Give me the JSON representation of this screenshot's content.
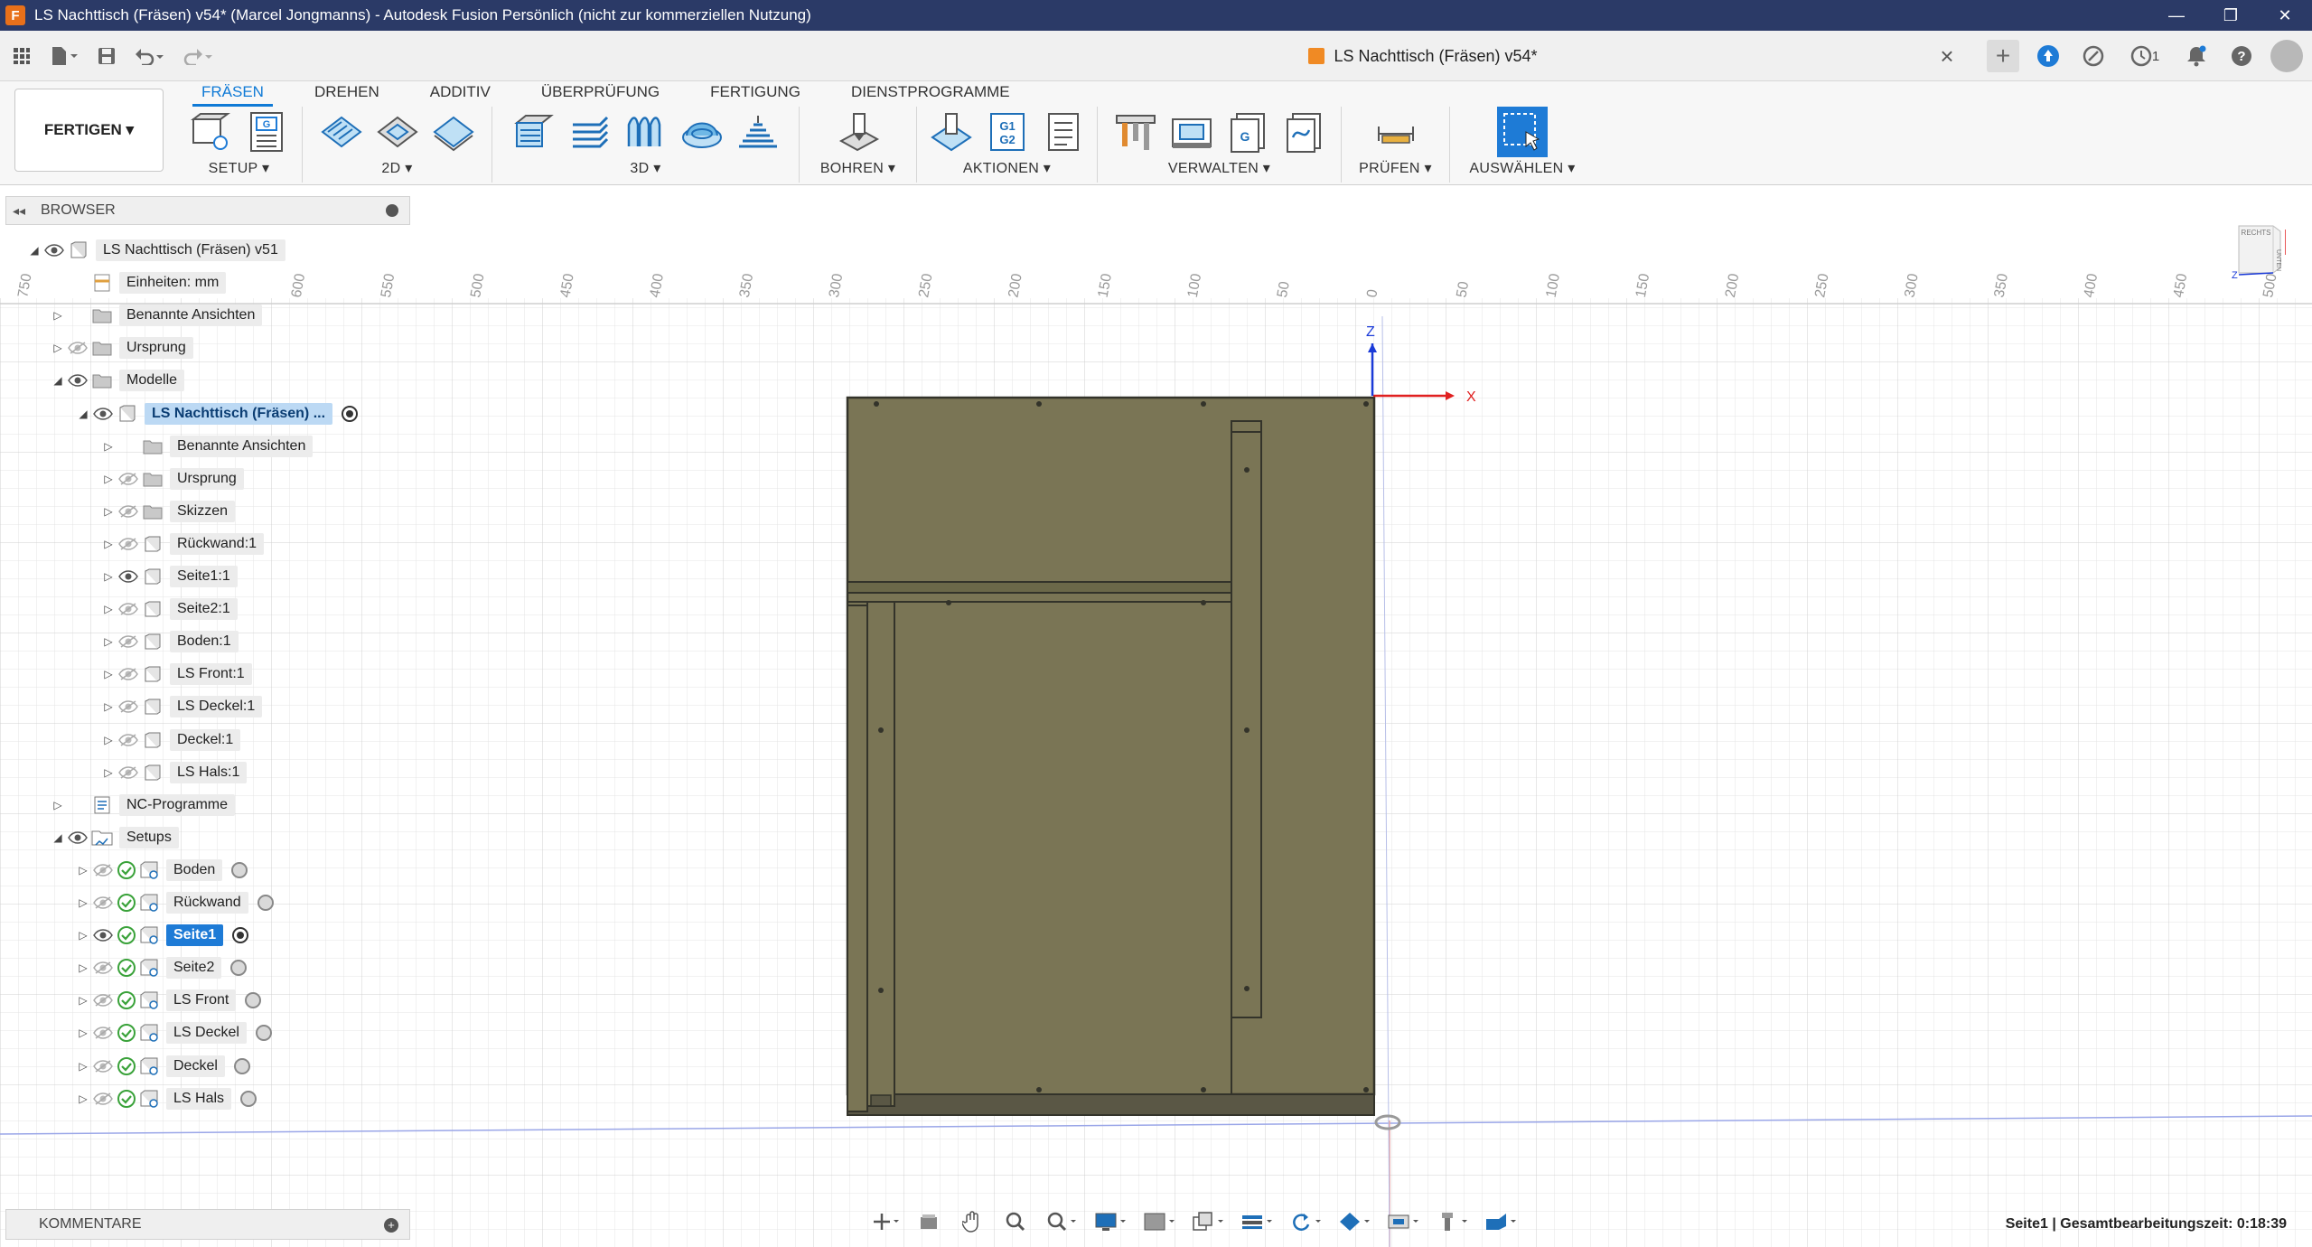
{
  "window": {
    "title": "LS Nachttisch (Fräsen) v54* (Marcel Jongmanns) - Autodesk Fusion Persönlich (nicht zur kommerziellen Nutzung)",
    "app_icon_letter": "F",
    "controls": [
      "—",
      "❐",
      "✕"
    ]
  },
  "document_tab": {
    "title": "LS Nachttisch (Fräsen) v54*"
  },
  "notifications": {
    "job_count": "1"
  },
  "workspace": {
    "label": "FERTIGEN ▾"
  },
  "ribbon": {
    "tabs": [
      {
        "label": "FRÄSEN",
        "active": true
      },
      {
        "label": "DREHEN"
      },
      {
        "label": "ADDITIV"
      },
      {
        "label": "ÜBERPRÜFUNG"
      },
      {
        "label": "FERTIGUNG"
      },
      {
        "label": "DIENSTPROGRAMME"
      }
    ],
    "groups": {
      "setup": "SETUP ▾",
      "g2d": "2D ▾",
      "g3d": "3D ▾",
      "bohren": "BOHREN ▾",
      "aktionen": "AKTIONEN ▾",
      "verwalten": "VERWALTEN ▾",
      "pruefen": "PRÜFEN ▾",
      "auswaehlen": "AUSWÄHLEN ▾"
    },
    "gcode_icon_text": [
      "G1",
      "G2"
    ],
    "setup_icon_text": "G"
  },
  "browser": {
    "title": "BROWSER",
    "root": "LS Nachttisch (Fräsen) v51",
    "units": "Einheiten: mm",
    "items": {
      "named_views": "Benannte Ansichten",
      "origin": "Ursprung",
      "models": "Modelle",
      "model_instance": "LS Nachttisch (Fräsen) ...",
      "sub_named_views": "Benannte Ansichten",
      "sub_origin": "Ursprung",
      "sketches": "Skizzen",
      "bodies": [
        "Rückwand:1",
        "Seite1:1",
        "Seite2:1",
        "Boden:1",
        "LS Front:1",
        "LS Deckel:1",
        "Deckel:1",
        "LS Hals:1"
      ],
      "nc_programs": "NC-Programme",
      "setups": "Setups",
      "setup_list": [
        "Boden",
        "Rückwand",
        "Seite1",
        "Seite2",
        "LS Front",
        "LS Deckel",
        "Deckel",
        "LS Hals"
      ]
    }
  },
  "comments": {
    "title": "KOMMENTARE"
  },
  "status": {
    "text": "Seite1 | Gesamtbearbeitungszeit: 0:18:39"
  },
  "ruler": {
    "left_labels": [
      "750",
      "600",
      "550",
      "500",
      "450",
      "400",
      "350",
      "300",
      "250",
      "200",
      "150",
      "100",
      "50",
      "0"
    ],
    "right_labels": [
      "50",
      "100",
      "150",
      "200",
      "250",
      "300",
      "350",
      "400",
      "450",
      "500"
    ]
  },
  "axes": {
    "x": "X",
    "z": "Z"
  },
  "viewcube": {
    "top": "RECHTS",
    "front": "UNTEN"
  },
  "colors": {
    "titlebar": "#2b3a67",
    "accent": "#0f7ad6",
    "part_fill": "#7a7555",
    "part_edge": "#3a3a30",
    "axis_x": "#e02020",
    "axis_z": "#1a3ad8",
    "check": "#3aa23a"
  }
}
